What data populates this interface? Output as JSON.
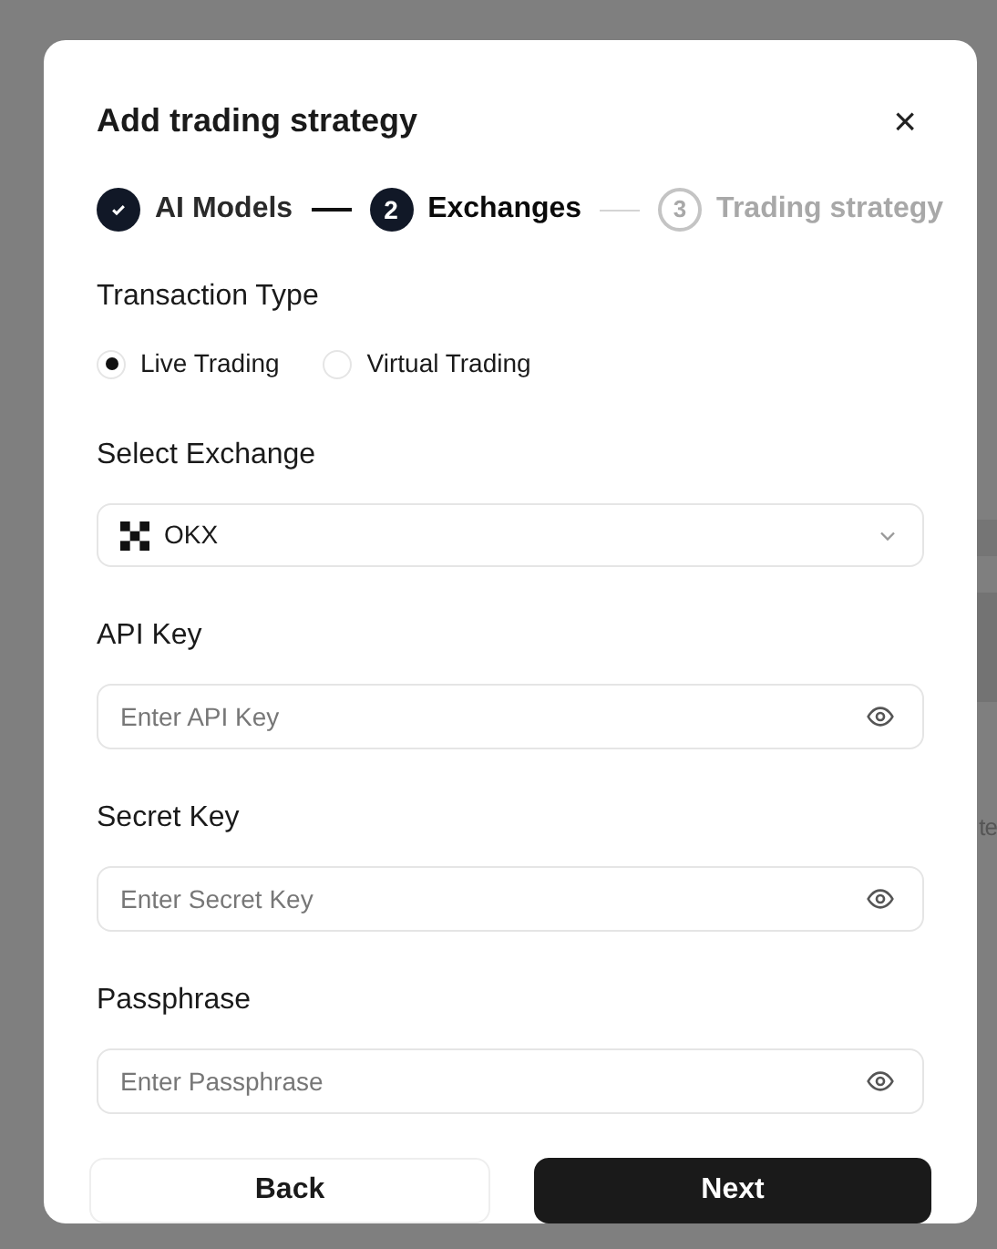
{
  "background": {
    "text": "te"
  },
  "dialog": {
    "title": "Add trading strategy",
    "close": "×"
  },
  "steps": [
    {
      "label": "AI Models",
      "completed": true,
      "selected": false
    },
    {
      "label": "Exchanges",
      "completed": false,
      "selected": true,
      "number": "2"
    },
    {
      "label": "Trading strategy",
      "completed": false,
      "selected": false,
      "number": "3"
    }
  ],
  "transaction_type": {
    "label": "Transaction Type",
    "options": [
      {
        "label": "Live Trading",
        "selected": true
      },
      {
        "label": "Virtual Trading",
        "selected": false
      }
    ]
  },
  "exchange": {
    "label": "Select Exchange",
    "value": "OKX"
  },
  "fields": [
    {
      "label": "API Key",
      "placeholder": "Enter API Key"
    },
    {
      "label": "Secret Key",
      "placeholder": "Enter Secret Key"
    },
    {
      "label": "Passphrase",
      "placeholder": "Enter Passphrase"
    }
  ],
  "buttons": {
    "back": "Back",
    "next": "Next"
  }
}
